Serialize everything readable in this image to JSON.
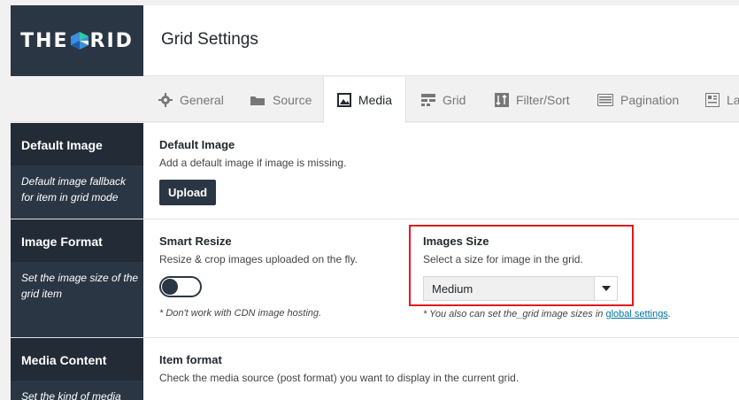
{
  "brand": {
    "logo_left": "THE",
    "logo_right": "RID",
    "logo_colors": [
      "#3d8fe0",
      "#2fc9a8",
      "#1f5ca8"
    ]
  },
  "header": {
    "title": "Grid Settings"
  },
  "tabs": [
    {
      "label": "General",
      "icon": "gear-icon"
    },
    {
      "label": "Source",
      "icon": "folder-icon"
    },
    {
      "label": "Media",
      "icon": "image-icon",
      "active": true
    },
    {
      "label": "Grid",
      "icon": "grid-icon"
    },
    {
      "label": "Filter/Sort",
      "icon": "filter-sort-icon"
    },
    {
      "label": "Pagination",
      "icon": "pagination-icon"
    },
    {
      "label": "La",
      "icon": "layout-icon"
    }
  ],
  "default_image": {
    "side_title": "Default Image",
    "side_desc": "Default image fallback for item in grid mode",
    "label": "Default Image",
    "desc": "Add a default image if image is missing.",
    "button": "Upload"
  },
  "image_format": {
    "side_title": "Image Format",
    "side_desc": "Set the image size of the grid item",
    "smart_resize": {
      "label": "Smart Resize",
      "desc": "Resize & crop images uploaded on the fly.",
      "note": "* Don't work with CDN image hosting."
    },
    "images_size": {
      "label": "Images Size",
      "desc": "Select a size for image in the grid.",
      "selected": "Medium",
      "note_prefix": "* You also can set the_grid image sizes in ",
      "note_link": "global settings",
      "note_suffix": "."
    }
  },
  "media_content": {
    "side_title": "Media Content",
    "side_desc": "Set the kind of media",
    "label": "Item format",
    "desc": "Check the media source (post format) you want to display in the current grid."
  },
  "colors": {
    "sidebar": "#2b3644",
    "highlight": "#e3191c",
    "link": "#0073aa"
  }
}
